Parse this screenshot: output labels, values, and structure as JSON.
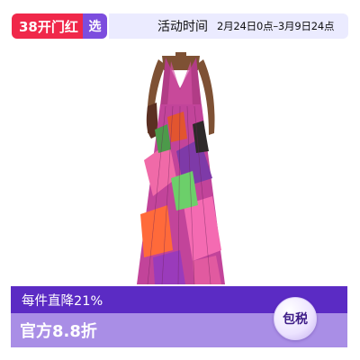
{
  "top": {
    "badge_38": "38开门红",
    "badge_xuan": "选",
    "time_label": "活动时间",
    "time_range": "2月24日0点–3月9日24点"
  },
  "colors": {
    "red": "#f0284a",
    "purple": "#7c4dde",
    "time_bg": "#ebebff",
    "bottom_dark": "#5b2bc4",
    "bottom_light": "#a98ee6"
  },
  "bottom": {
    "discount": "每件直降21%",
    "official": "官方8.8折",
    "tax_badge": "包税"
  }
}
